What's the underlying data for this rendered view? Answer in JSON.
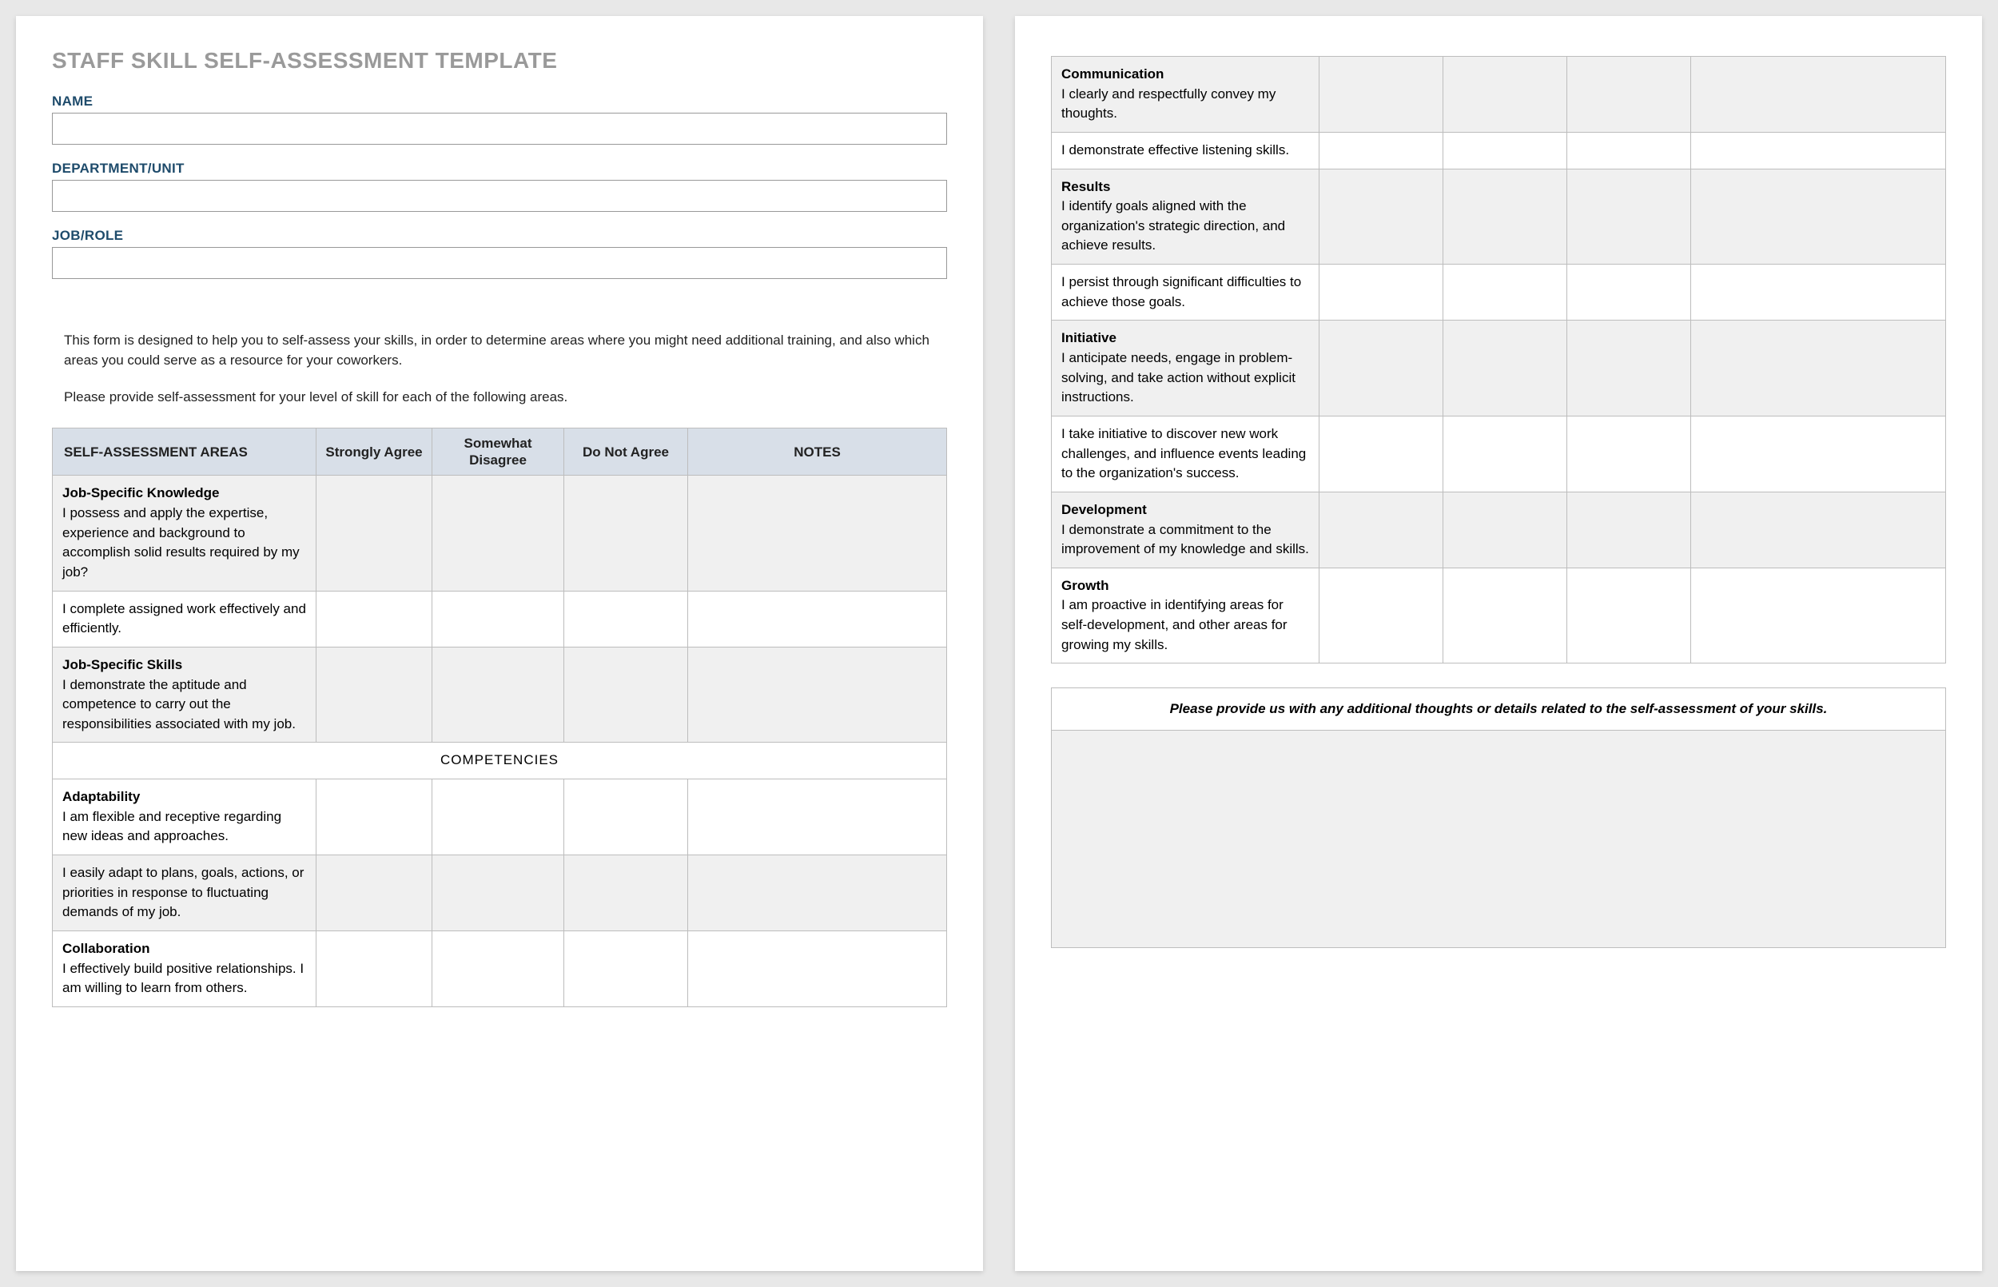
{
  "title": "STAFF SKILL SELF-ASSESSMENT TEMPLATE",
  "fields": {
    "name_label": "NAME",
    "dept_label": "DEPARTMENT/UNIT",
    "role_label": "JOB/ROLE",
    "name_value": "",
    "dept_value": "",
    "role_value": ""
  },
  "intro": {
    "p1": "This form is designed to help you to self-assess your skills, in order to determine areas where you might need additional training, and also which areas you could serve as a resource for your coworkers.",
    "p2": "Please provide self-assessment for your level of skill for each of the following areas."
  },
  "columns": {
    "areas": "SELF-ASSESSMENT AREAS",
    "strongly": "Strongly Agree",
    "somewhat": "Somewhat Disagree",
    "donot": "Do Not Agree",
    "notes": "NOTES"
  },
  "section_competencies": "COMPETENCIES",
  "rows_page1": [
    {
      "heading": "Job-Specific Knowledge",
      "text": "I possess and apply the expertise, experience and background to accomplish solid results required by my job?",
      "shaded": true
    },
    {
      "heading": "",
      "text": "I complete assigned work effectively and efficiently.",
      "shaded": false
    },
    {
      "heading": "Job-Specific Skills",
      "text": "I demonstrate the aptitude and competence to carry out the responsibilities associated with my job.",
      "shaded": true
    },
    {
      "heading": "Adaptability",
      "text": "I am flexible and receptive regarding new ideas and approaches.",
      "shaded": false
    },
    {
      "heading": "",
      "text": "I easily adapt to plans, goals, actions, or priorities in response to fluctuating demands of my job.",
      "shaded": true
    },
    {
      "heading": "Collaboration",
      "text": "I effectively build positive relationships. I am willing to learn from others.",
      "shaded": false
    }
  ],
  "rows_page2": [
    {
      "heading": "Communication",
      "text": "I clearly and respectfully convey my thoughts.",
      "shaded": true
    },
    {
      "heading": "",
      "text": "I demonstrate effective listening skills.",
      "shaded": false
    },
    {
      "heading": "Results",
      "text": "I identify goals aligned with the organization's strategic direction, and achieve results.",
      "shaded": true
    },
    {
      "heading": "",
      "text": "I persist through significant difficulties to achieve those goals.",
      "shaded": false
    },
    {
      "heading": "Initiative",
      "text": "I anticipate needs, engage in problem-solving, and take action without explicit instructions.",
      "shaded": true
    },
    {
      "heading": "",
      "text": "I take initiative to discover new work challenges, and influence events leading to the organization's success.",
      "shaded": false
    },
    {
      "heading": "Development",
      "text": "I demonstrate a commitment to the improvement of my knowledge and skills.",
      "shaded": true
    },
    {
      "heading": "Growth",
      "text": "I am proactive in identifying areas for self-development, and other areas for growing my skills.",
      "shaded": false
    }
  ],
  "additional_prompt": "Please provide us with any additional thoughts or details related to the self-assessment of your skills.",
  "additional_value": ""
}
